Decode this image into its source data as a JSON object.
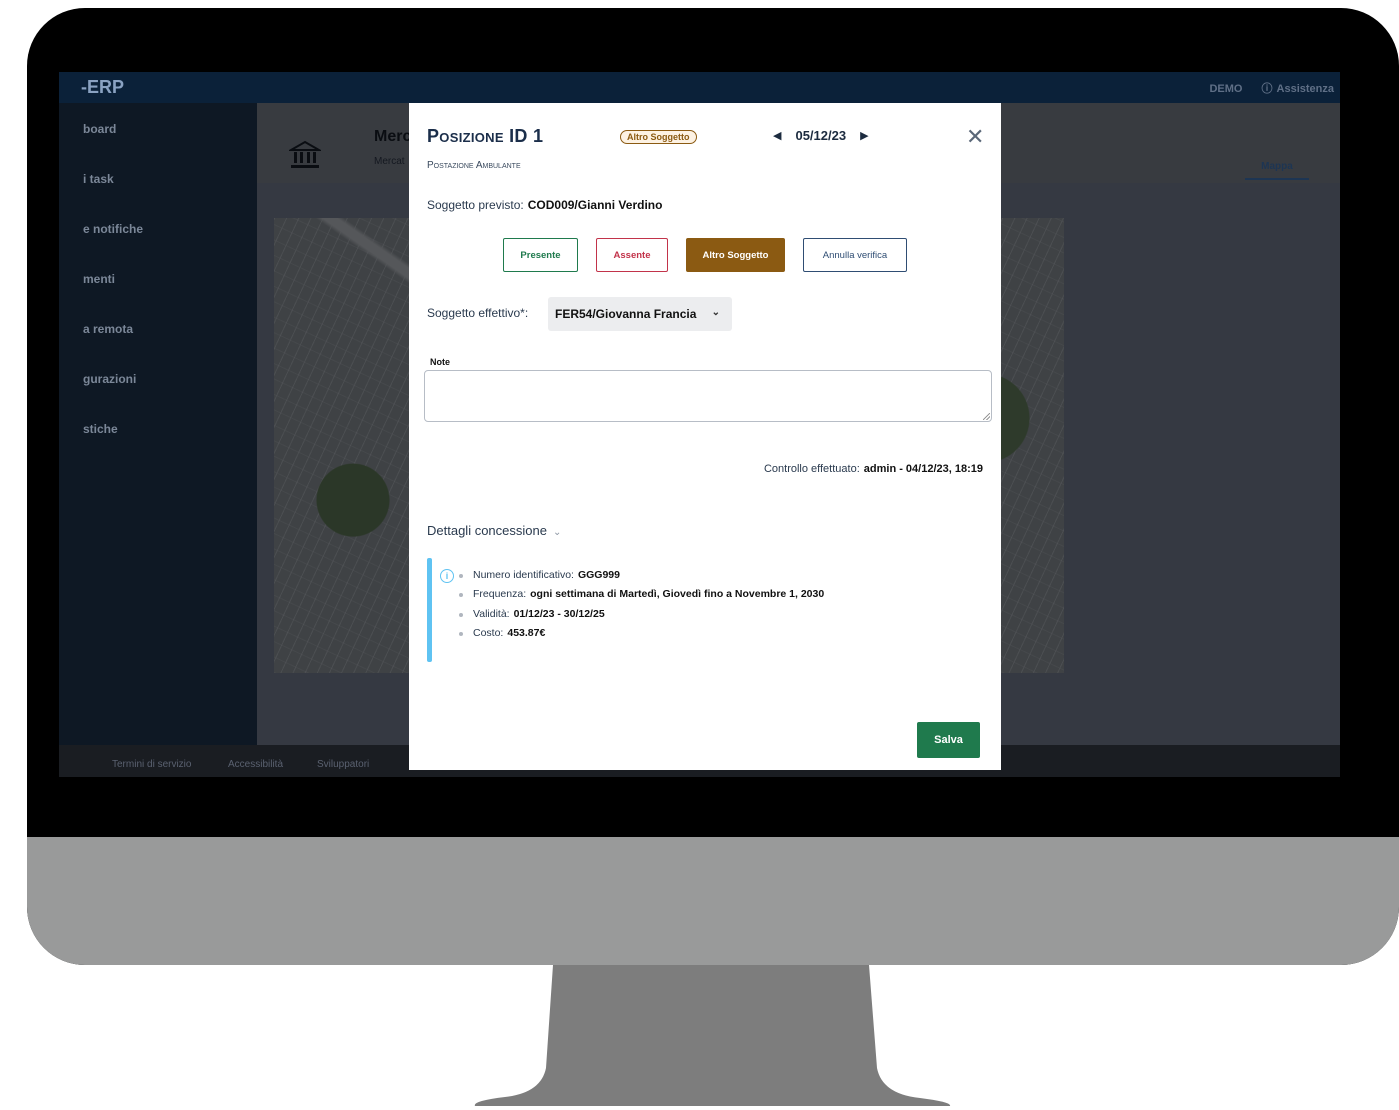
{
  "app": {
    "brand": "-ERP",
    "top_right": {
      "demo": "DEMO",
      "help": "Assistenza"
    }
  },
  "sidebar": {
    "items": [
      {
        "label": "board"
      },
      {
        "label": "i task"
      },
      {
        "label": "e notifiche"
      },
      {
        "label": "menti"
      },
      {
        "label": "a remota"
      },
      {
        "label": "gurazioni"
      },
      {
        "label": "stiche"
      }
    ]
  },
  "page": {
    "title": "Merc",
    "subtitle": "Mercat",
    "tab_map": "Mappa"
  },
  "footer": {
    "links": [
      "Termini di servizio",
      "Accessibilità",
      "Sviluppatori"
    ]
  },
  "modal": {
    "title": "Posizione ID 1",
    "subtitle": "Postazione Ambulante",
    "badge": "Altro Soggetto",
    "date": "05/12/23",
    "expected_label": "Soggetto previsto:",
    "expected_value": "COD009/Gianni Verdino",
    "buttons": {
      "present": "Presente",
      "absent": "Assente",
      "other": "Altro Soggetto",
      "cancel": "Annulla verifica"
    },
    "effective_label": "Soggetto effettivo*:",
    "effective_value": "FER54/Giovanna Francia",
    "note_label": "Note",
    "note_value": "",
    "control_label": "Controllo effettuato:",
    "control_value": "admin - 04/12/23, 18:19",
    "details_label": "Dettagli concessione",
    "details": [
      {
        "label": "Numero identificativo:",
        "value": "GGG999"
      },
      {
        "label": "Frequenza:",
        "value": "ogni settimana di Martedì, Giovedì fino a Novembre 1, 2030"
      },
      {
        "label": "Validità:",
        "value": "01/12/23 - 30/12/25"
      },
      {
        "label": "Costo:",
        "value": "453.87€"
      }
    ],
    "save": "Salva"
  },
  "colors": {
    "present": "#1f7a4d",
    "absent": "#c2334a",
    "other": "#8b5a12",
    "info": "#5fc3f2"
  }
}
